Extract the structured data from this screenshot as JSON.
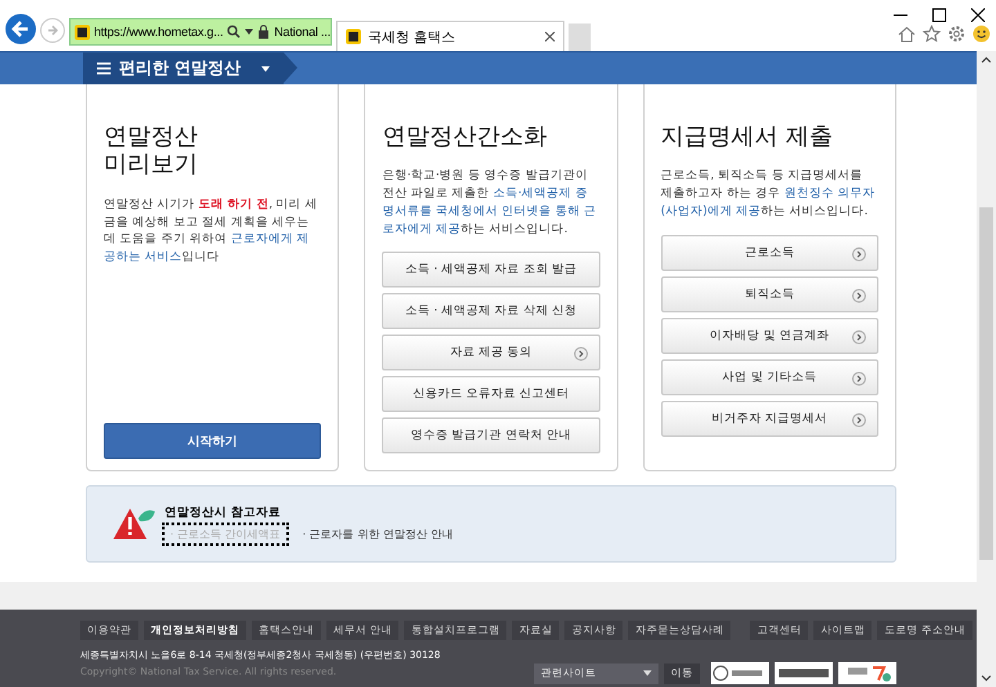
{
  "browser": {
    "address": "https://www.hometax.g...",
    "security": "National ...",
    "tabs": [
      {
        "label": "국세청 홈택스",
        "selected": true
      }
    ]
  },
  "nav": {
    "title": "편리한 연말정산"
  },
  "cards": [
    {
      "title": "연말정산\n미리보기",
      "description": [
        {
          "text": "연말정산 시기가 ",
          "kind": "plain"
        },
        {
          "text": "도래 하기 전",
          "kind": "warn"
        },
        {
          "text": ", 미리 세금을 예상해 보고 절세 계획을 세우는데 도움을 주기 위하여 ",
          "kind": "plain"
        },
        {
          "text": "근로자에게 제공하는 서비스",
          "kind": "highlight"
        },
        {
          "text": "입니다",
          "kind": "plain"
        }
      ],
      "buttons": [
        {
          "label": "시작하기",
          "kind": "primary"
        }
      ]
    },
    {
      "title": "연말정산간소화",
      "description": [
        {
          "text": "은행·학교·병원 등 영수증 발급기관이 전산 파일로 제출한 ",
          "kind": "plain"
        },
        {
          "text": "소득·세액공제 증명서류를 국세청에서 인터넷을 통해 근로자에게 제공",
          "kind": "highlight"
        },
        {
          "text": "하는 서비스입니다.",
          "kind": "plain"
        }
      ],
      "buttons": [
        {
          "label": "소득 · 세액공제 자료 조회 발급",
          "kind": "plain",
          "arrow": false
        },
        {
          "label": "소득 · 세액공제 자료 삭제 신청",
          "kind": "plain",
          "arrow": false
        },
        {
          "label": "자료 제공 동의",
          "kind": "plain",
          "arrow": true
        },
        {
          "label": "신용카드 오류자료 신고센터",
          "kind": "plain",
          "arrow": false
        },
        {
          "label": "영수증 발급기관 연락처 안내",
          "kind": "plain",
          "arrow": false
        }
      ]
    },
    {
      "title": "지급명세서 제출",
      "description": [
        {
          "text": "근로소득, 퇴직소득 등 지급명세서를 제출하고자 하는 경우 ",
          "kind": "plain"
        },
        {
          "text": "원천징수 의무자(사업자)에게 제공",
          "kind": "highlight"
        },
        {
          "text": "하는 서비스입니다.",
          "kind": "plain"
        }
      ],
      "buttons": [
        {
          "label": "근로소득",
          "kind": "plain",
          "arrow": true
        },
        {
          "label": "퇴직소득",
          "kind": "plain",
          "arrow": true
        },
        {
          "label": "이자배당 및 연금계좌",
          "kind": "plain",
          "arrow": true
        },
        {
          "label": "사업 및 기타소득",
          "kind": "plain",
          "arrow": true
        },
        {
          "label": "비거주자 지급명세서",
          "kind": "plain",
          "arrow": true
        }
      ]
    }
  ],
  "notice": {
    "title": "연말정산시 참고자료",
    "links": [
      {
        "label": "· 근로소득 간이세액표",
        "focused": true
      },
      {
        "label": "· 근로자를 위한 연말정산 안내",
        "focused": false
      }
    ]
  },
  "footer": {
    "links": [
      {
        "label": "이용약관",
        "kind": "normal"
      },
      {
        "label": "개인정보처리방침",
        "kind": "emphasis"
      },
      {
        "label": "홈택스안내",
        "kind": "normal"
      },
      {
        "label": "세무서 안내",
        "kind": "normal"
      },
      {
        "label": "통합설치프로그램",
        "kind": "normal"
      },
      {
        "label": "자료실",
        "kind": "normal"
      },
      {
        "label": "공지사항",
        "kind": "normal"
      },
      {
        "label": "자주묻는상담사례",
        "kind": "normal"
      },
      {
        "label": "고객센터",
        "kind": "normal"
      },
      {
        "label": "사이트맵",
        "kind": "normal"
      },
      {
        "label": "도로명 주소안내",
        "kind": "normal"
      }
    ],
    "address": "세종특별자치시 노을6로 8-14 국세청(정부세종2청사 국세청동) (우편번호) 30128",
    "copyright": "Copyright© National Tax Service. All rights reserved.",
    "site_select": "관련사이트",
    "go_button": "이동"
  }
}
